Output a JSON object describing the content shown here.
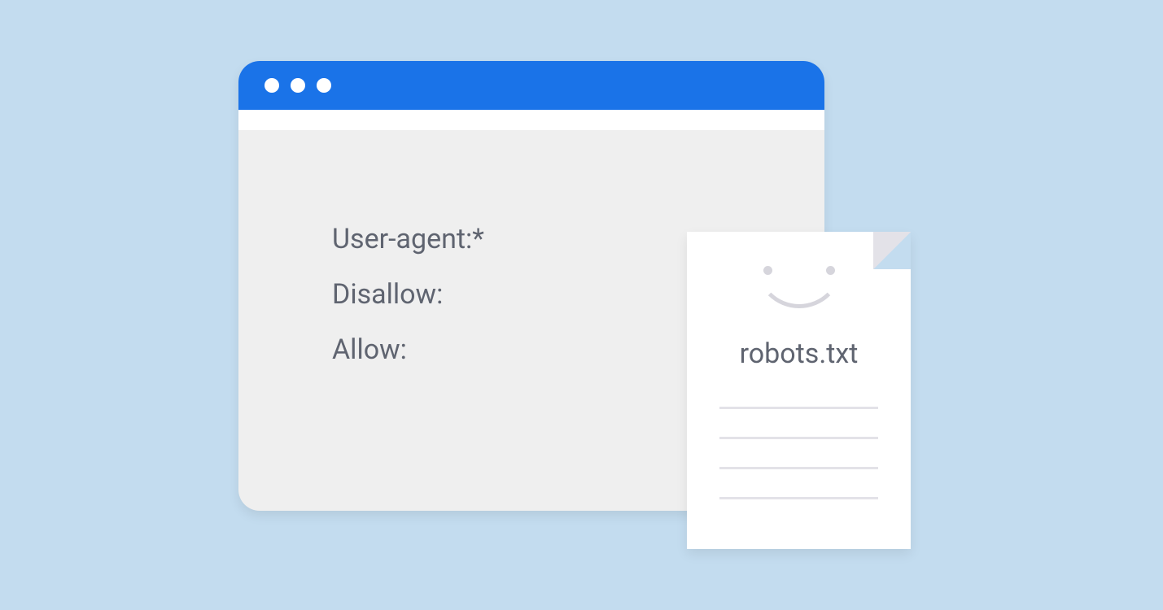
{
  "browser": {
    "lines": [
      "User-agent:*",
      "Disallow:",
      "Allow:"
    ]
  },
  "file": {
    "title": "robots.txt"
  }
}
